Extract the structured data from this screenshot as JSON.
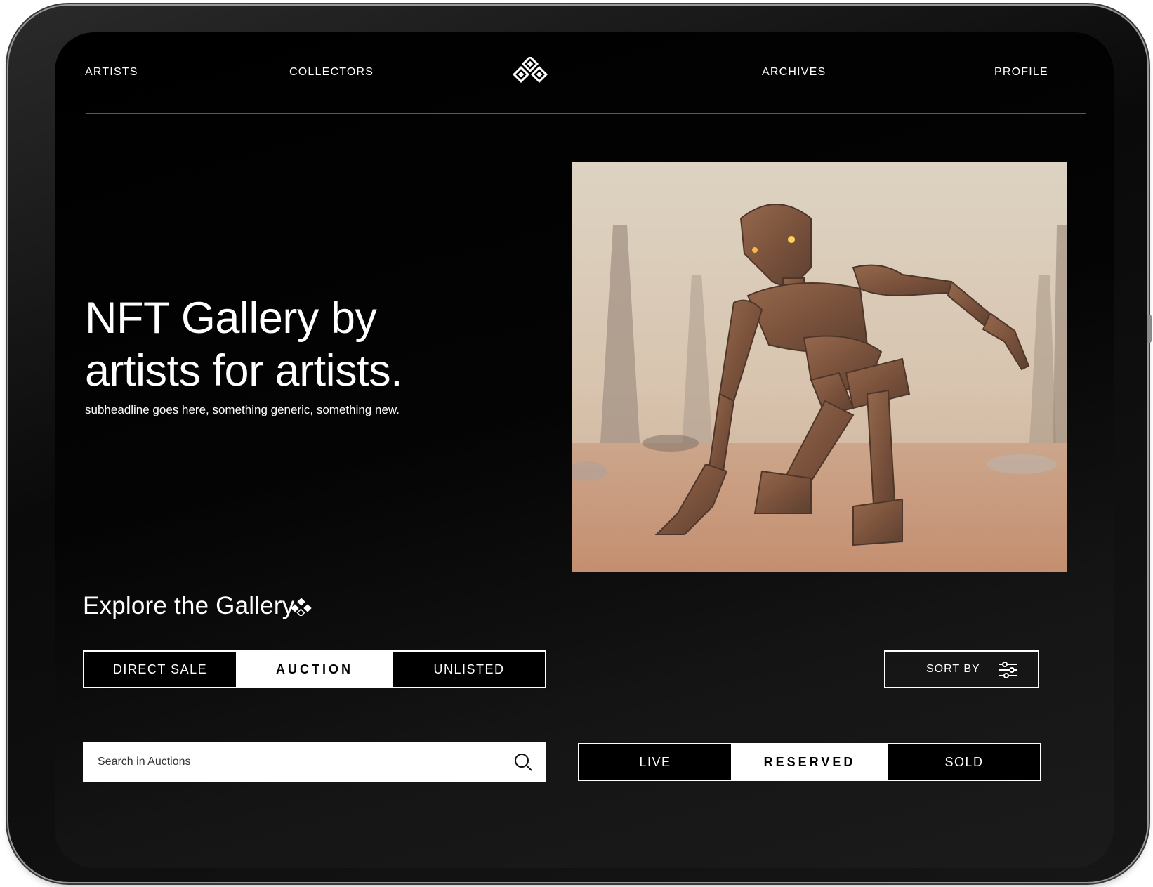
{
  "nav": {
    "items": [
      "ARTISTS",
      "COLLECTORS",
      "ARCHIVES",
      "PROFILE"
    ],
    "logo_icon": "diamond-cluster-logo-icon"
  },
  "hero": {
    "title": "NFT Gallery by artists for artists.",
    "subtitle": "subheadline goes here, something generic, something new.",
    "image": "rusted-robot-kneeling-in-desert"
  },
  "explore": {
    "title": "Explore the Gallery",
    "icon": "diamond-cluster-icon"
  },
  "sale_tabs": {
    "items": [
      "DIRECT SALE",
      "AUCTION",
      "UNLISTED"
    ],
    "active": "AUCTION"
  },
  "sort": {
    "label": "SORT BY",
    "icon": "sliders-icon"
  },
  "search": {
    "placeholder": "Search in Auctions",
    "icon": "search-icon"
  },
  "status_tabs": {
    "items": [
      "LIVE",
      "RESERVED",
      "SOLD"
    ],
    "active": "RESERVED"
  },
  "colors": {
    "background": "#000000",
    "text": "#ffffff",
    "active_tab_bg": "#ffffff",
    "active_tab_text": "#000000"
  }
}
